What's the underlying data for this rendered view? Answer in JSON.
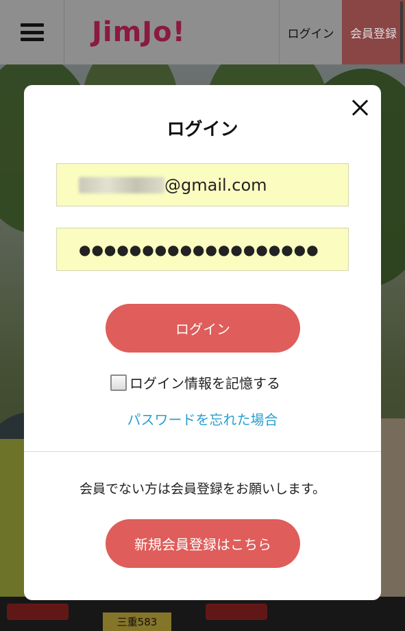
{
  "header": {
    "logo": "JimJo!",
    "login_label": "ログイン",
    "register_label": "会員登録"
  },
  "modal": {
    "title": "ログイン",
    "email_visible_suffix": "@gmail.com",
    "password_mask": "●●●●●●●●●●●●●●●●●●●",
    "login_button": "ログイン",
    "remember_label": "ログイン情報を記憶する",
    "forgot_link": "パスワードを忘れた場合",
    "notice": "会員でない方は会員登録をお願いします。",
    "register_button": "新規会員登録はこちら"
  },
  "background": {
    "plate_text": "三重583"
  },
  "colors": {
    "accent": "#df5d5a",
    "link": "#2a9fd0",
    "input_bg": "#fafcc0",
    "logo": "#8a1a3f"
  }
}
